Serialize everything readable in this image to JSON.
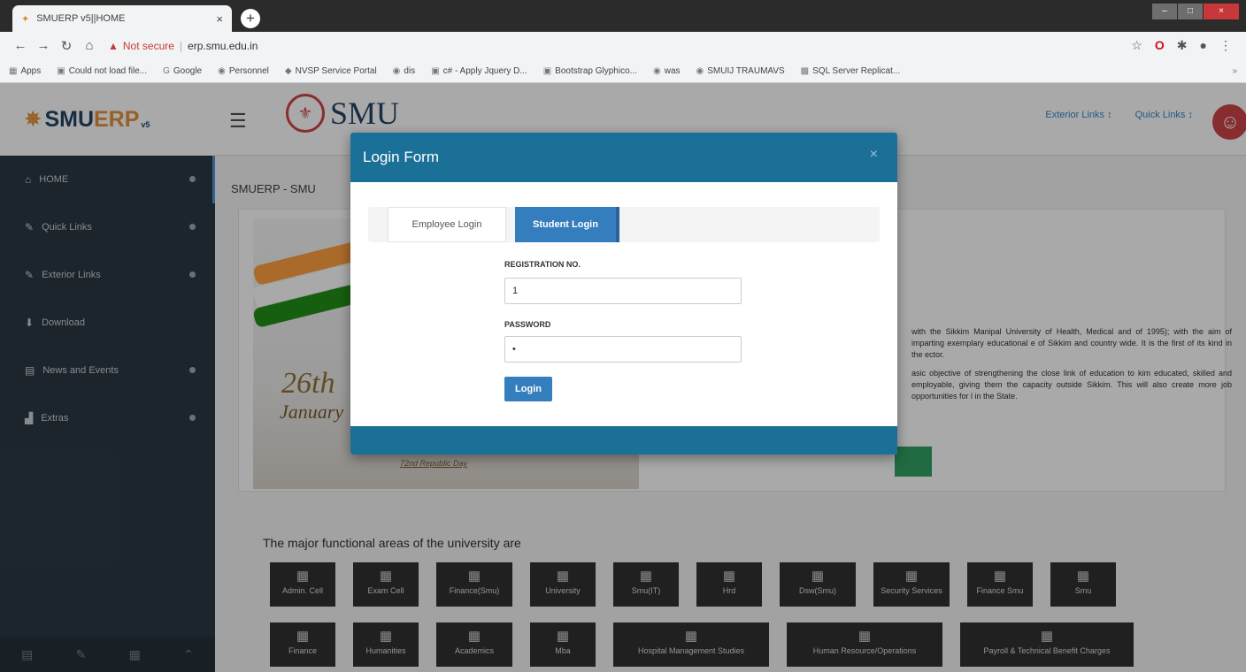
{
  "browser": {
    "tab_title": "SMUERP v5||HOME",
    "address": "erp.smu.edu.in",
    "not_secure": "Not secure",
    "bookmarks": [
      {
        "icon": "apps-icon",
        "label": "Apps"
      },
      {
        "icon": "page-icon",
        "label": "Could not load file..."
      },
      {
        "icon": "google-icon",
        "label": "Google"
      },
      {
        "icon": "globe-icon",
        "label": "Personnel"
      },
      {
        "icon": "diamond-icon",
        "label": "NVSP Service Portal"
      },
      {
        "icon": "globe-icon",
        "label": "dis"
      },
      {
        "icon": "page-icon",
        "label": "c# - Apply Jquery D..."
      },
      {
        "icon": "page-icon",
        "label": "Bootstrap Glyphico..."
      },
      {
        "icon": "globe-icon",
        "label": "was"
      },
      {
        "icon": "globe-icon",
        "label": "SMUIJ TRAUMAVS"
      },
      {
        "icon": "database-icon",
        "label": "SQL Server Replicat..."
      }
    ]
  },
  "app": {
    "brand_prefix": "SMU",
    "brand_suffix": "ERP",
    "brand_version": "v5",
    "logo_text": "SMU",
    "top_links": [
      "Exterior Links ↕",
      "Quick Links ↕"
    ],
    "breadcrumb": "SMUERP - SMU",
    "sidebar": [
      {
        "icon": "home-icon",
        "label": "HOME",
        "dot": true
      },
      {
        "icon": "edit-icon",
        "label": "Quick Links",
        "dot": true
      },
      {
        "icon": "edit-icon",
        "label": "Exterior Links",
        "dot": true
      },
      {
        "icon": "download-icon",
        "label": "Download",
        "dot": false
      },
      {
        "icon": "calendar-icon",
        "label": "News and Events",
        "dot": true
      },
      {
        "icon": "chart-icon",
        "label": "Extras",
        "dot": true
      }
    ],
    "banner": {
      "big": "26th",
      "month": "January",
      "caption": "72nd Republic Day"
    },
    "about": [
      "with the Sikkim Manipal University of Health, Medical and of 1995); with the aim of imparting exemplary educational e of Sikkim and country wide. It is the first of its kind in the ector.",
      "asic objective of strengthening the close link of education to kim educated, skilled and employable, giving them the capacity outside Sikkim. This will also create more job opportunities for l in the State."
    ],
    "areas_title": "The major functional areas of the university are",
    "areas_row1": [
      "Admin. Cell",
      "Exam Cell",
      "Finance(Smu)",
      "University",
      "Smu(IT)",
      "Hrd",
      "Dsw(Smu)",
      "Security Services",
      "Finance Smu",
      "Smu"
    ],
    "areas_row2": [
      "Finance",
      "Humanities",
      "Academics",
      "Mba",
      "Hospital Management Studies",
      "Human Resource/Operations",
      "Payroll & Technical Benefit Charges"
    ]
  },
  "modal": {
    "title": "Login Form",
    "close": "×",
    "tab_employee": "Employee Login",
    "tab_student": "Student Login",
    "reg_label": "REGISTRATION NO.",
    "reg_value": "1",
    "pwd_label": "PASSWORD",
    "pwd_value": "•",
    "login_button": "Login"
  }
}
